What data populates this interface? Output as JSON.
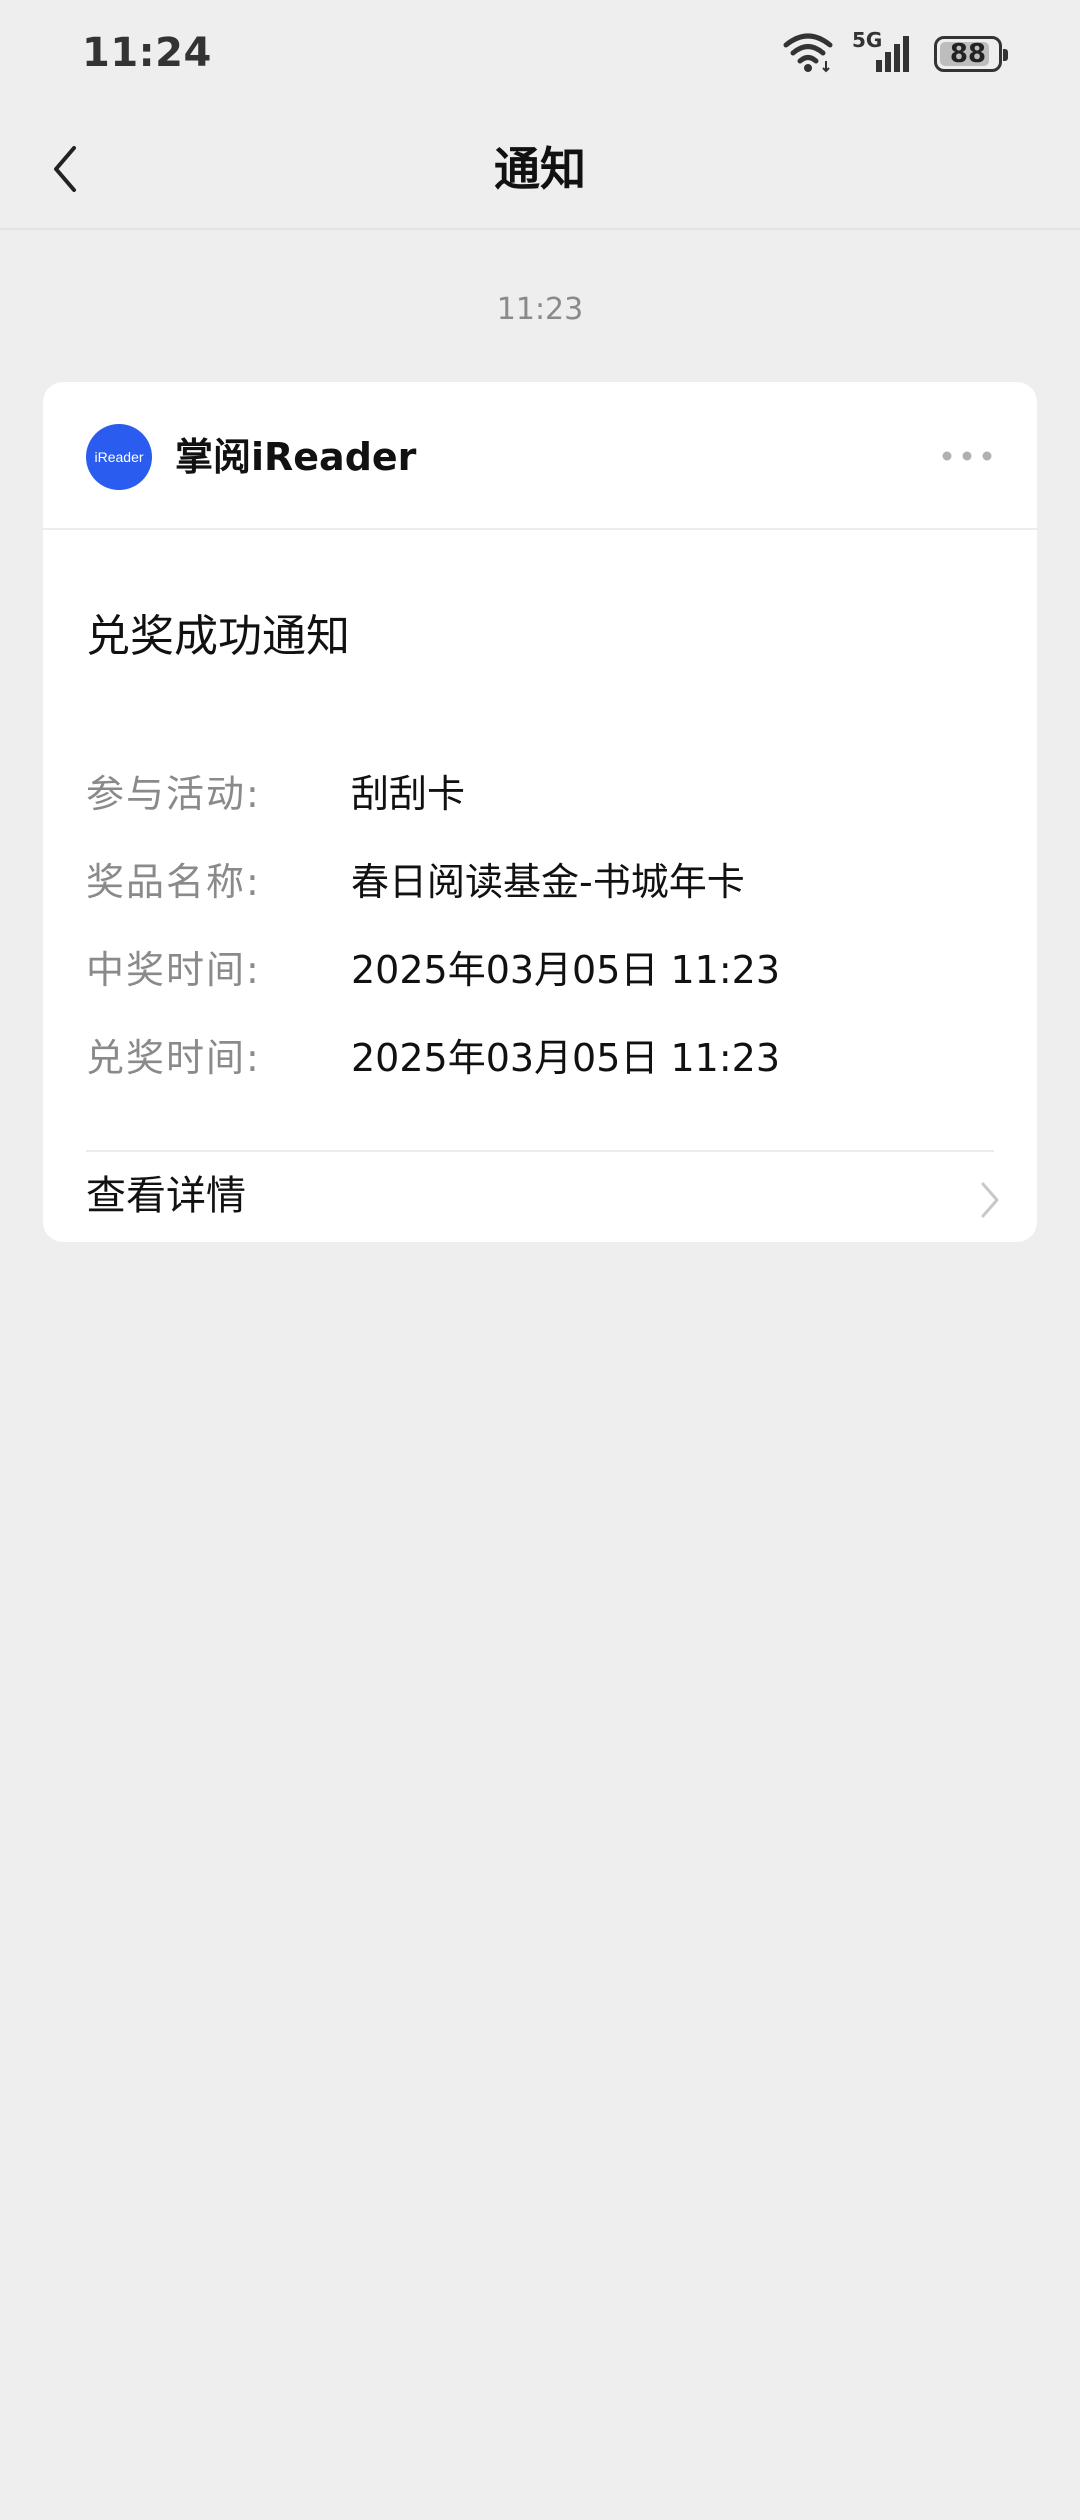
{
  "status_bar": {
    "time": "11:24",
    "network": "5G",
    "battery": 88
  },
  "header": {
    "title": "通知"
  },
  "message": {
    "timestamp": "11:23",
    "card": {
      "logo_text": "iReader",
      "app_name": "掌阅iReader",
      "title": "兑奖成功通知",
      "rows": [
        {
          "label": "参与活动:",
          "value": "刮刮卡"
        },
        {
          "label": "奖品名称:",
          "value": "春日阅读基金-书城年卡"
        },
        {
          "label": "中奖时间:",
          "value": "2025年03月05日 11:23"
        },
        {
          "label": "兑奖时间:",
          "value": "2025年03月05日 11:23"
        }
      ],
      "action_label": "查看详情"
    }
  },
  "colors": {
    "background": "#eeeeee",
    "card": "#ffffff",
    "brand_blue": "#2a5cf0",
    "label_gray": "#8a8a8a"
  }
}
